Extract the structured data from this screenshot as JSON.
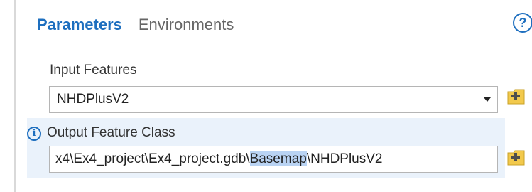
{
  "tabs": {
    "parameters_label": "Parameters",
    "environments_label": "Environments"
  },
  "help": {
    "glyph": "?"
  },
  "input_features": {
    "label": "Input Features",
    "value": "NHDPlusV2"
  },
  "output_feature_class": {
    "label": "Output Feature Class",
    "info_glyph": "i",
    "value_before": "x4\\Ex4_project\\Ex4_project.gdb\\",
    "value_selected": "Basemap",
    "value_after": "\\NHDPlusV2"
  },
  "icons": {
    "help": "help-circle-icon",
    "info": "info-icon",
    "dropdown": "chevron-down-icon",
    "browse": "add-folder-icon"
  },
  "colors": {
    "accent": "#1e6fbf",
    "folder": "#f2c94c",
    "selection": "#b9d3f3",
    "output_row_highlight": "#eaf2fb"
  }
}
